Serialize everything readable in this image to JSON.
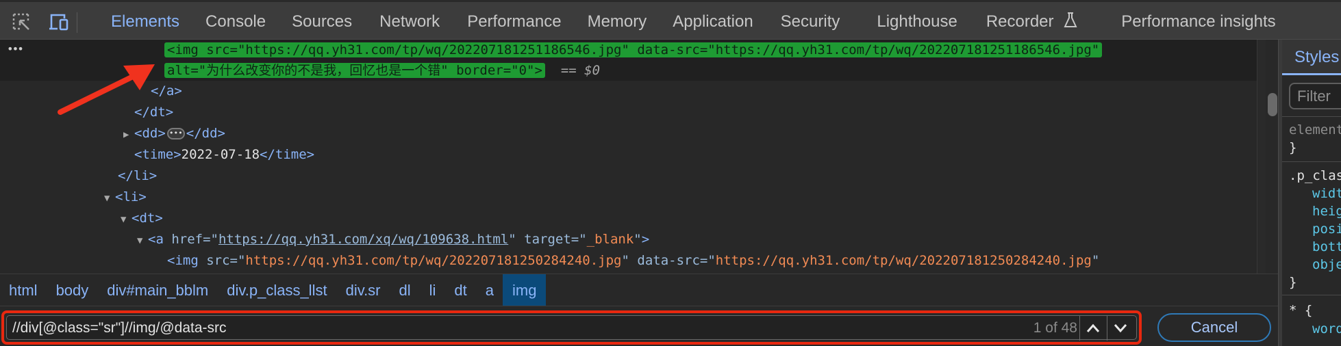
{
  "toolbar": {
    "inspect_icon": "inspect-element-icon",
    "device_icon": "device-toolbar-icon"
  },
  "tabs": [
    {
      "label": "Elements",
      "active": true
    },
    {
      "label": "Console"
    },
    {
      "label": "Sources"
    },
    {
      "label": "Network"
    },
    {
      "label": "Performance"
    },
    {
      "label": "Memory"
    },
    {
      "label": "Application"
    },
    {
      "label": "Security"
    },
    {
      "label": "Lighthouse"
    },
    {
      "label": "Recorder",
      "icon": "flask-icon"
    },
    {
      "label": "Performance insights"
    }
  ],
  "tree": {
    "selected_line1": "<img src=\"https://qq.yh31.com/tp/wq/202207181251186546.jpg\" data-src=\"https://qq.yh31.com/tp/wq/202207181251186546.jpg\"",
    "selected_line2": "alt=\"为什么改变你的不是我，回忆也是一个错\" border=\"0\">",
    "selected_marker": "== ",
    "selected_var": "$0",
    "close_a": "</a>",
    "close_dt": "</dt>",
    "dd_open": "<dd>",
    "dd_close": "</dd>",
    "time_open": "<time>",
    "time_value": "2022-07-18",
    "time_close": "</time>",
    "close_li": "</li>",
    "li_open": "<li>",
    "dt_open": "<dt>",
    "a_tag_open": "<a ",
    "a_href_attr": "href",
    "a_href_value": "https://qq.yh31.com/xq/wq/109638.html",
    "a_target_attr": "target",
    "a_target_value": "_blank",
    "img2_open": "<img ",
    "img2_src_attr": "src",
    "img2_src_value": "https://qq.yh31.com/tp/wq/202207181250284240.jpg",
    "img2_datasrc_attr": "data-src",
    "img2_datasrc_value": "https://qq.yh31.com/tp/wq/202207181250284240.jpg"
  },
  "breadcrumbs": [
    "html",
    "body",
    "div#main_bblm",
    "div.p_class_llst",
    "div.sr",
    "dl",
    "li",
    "dt",
    "a",
    "img"
  ],
  "search": {
    "value": "//div[@class=\"sr\"]//img/@data-src",
    "match_count": "1 of 48",
    "cancel_label": "Cancel"
  },
  "styles": {
    "tab_label": "Styles",
    "filter_placeholder": "Filter",
    "element_selector": "element.style {",
    "close_brace": "}",
    "rule_selector": ".p_class_llst .sr img {",
    "rule_props": [
      "width",
      "height",
      "position",
      "bottom",
      "object-fit"
    ],
    "universal_selector": "* {",
    "universal_props": [
      "word-break"
    ]
  },
  "colors": {
    "accent": "#8ab4f8",
    "selection_highlight": "#1e9b33",
    "search_outline": "#e8280f",
    "attr_value": "#f28b54"
  }
}
